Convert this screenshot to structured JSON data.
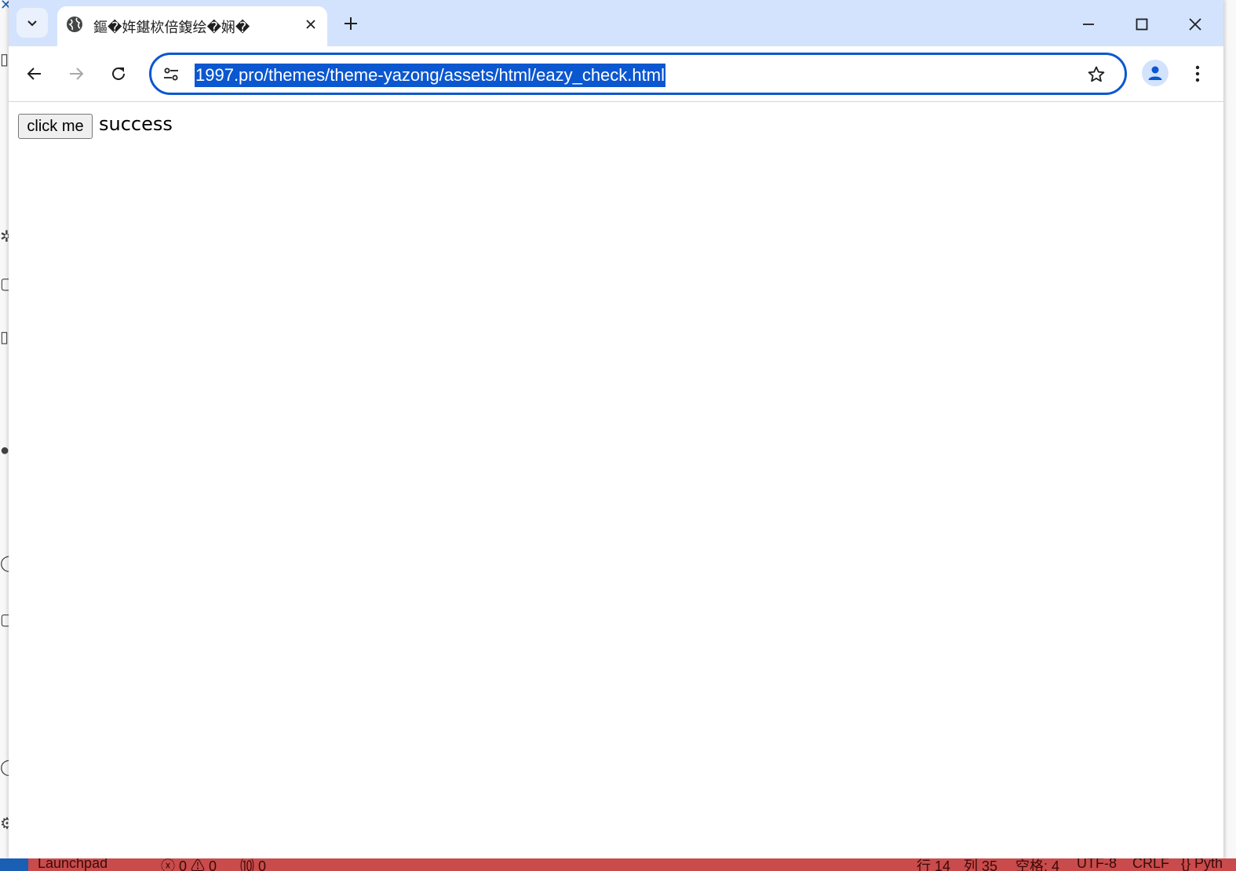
{
  "browser": {
    "tab": {
      "title": "鏂�姩鍖栨倍鍑绘�娴�",
      "close_glyph": "✕"
    },
    "new_tab_glyph": "+",
    "address_bar": {
      "url": "1997.pro/themes/theme-yazong/assets/html/eazy_check.html"
    },
    "icons": {
      "tab_search": "chevron-down-icon",
      "favicon": "globe-icon",
      "back": "arrow-left-icon",
      "forward": "arrow-right-icon",
      "reload": "reload-icon",
      "site_info": "tune-icon",
      "bookmark": "star-icon",
      "profile": "person-icon",
      "menu": "more-vert-icon",
      "minimize": "minimize-icon",
      "maximize": "maximize-icon",
      "close_window": "close-icon"
    },
    "colors": {
      "tabbar": "#d3e3fd",
      "accent": "#0b57d0"
    }
  },
  "page": {
    "button_label": "click me",
    "result_text": "success"
  },
  "background_app": {
    "statusbar": {
      "launchpad": "Launchpad",
      "problems": "ⓧ 0 ⚠ 0",
      "ports": "⑽ 0",
      "line": "行 14",
      "column": "列 35",
      "spaces": "空格: 4",
      "encoding": "UTF-8",
      "eol": "CRLF",
      "language": "{} Pyth"
    },
    "colors": {
      "statusbar": "#c94b4b",
      "remote": "#1a5fb4"
    }
  }
}
